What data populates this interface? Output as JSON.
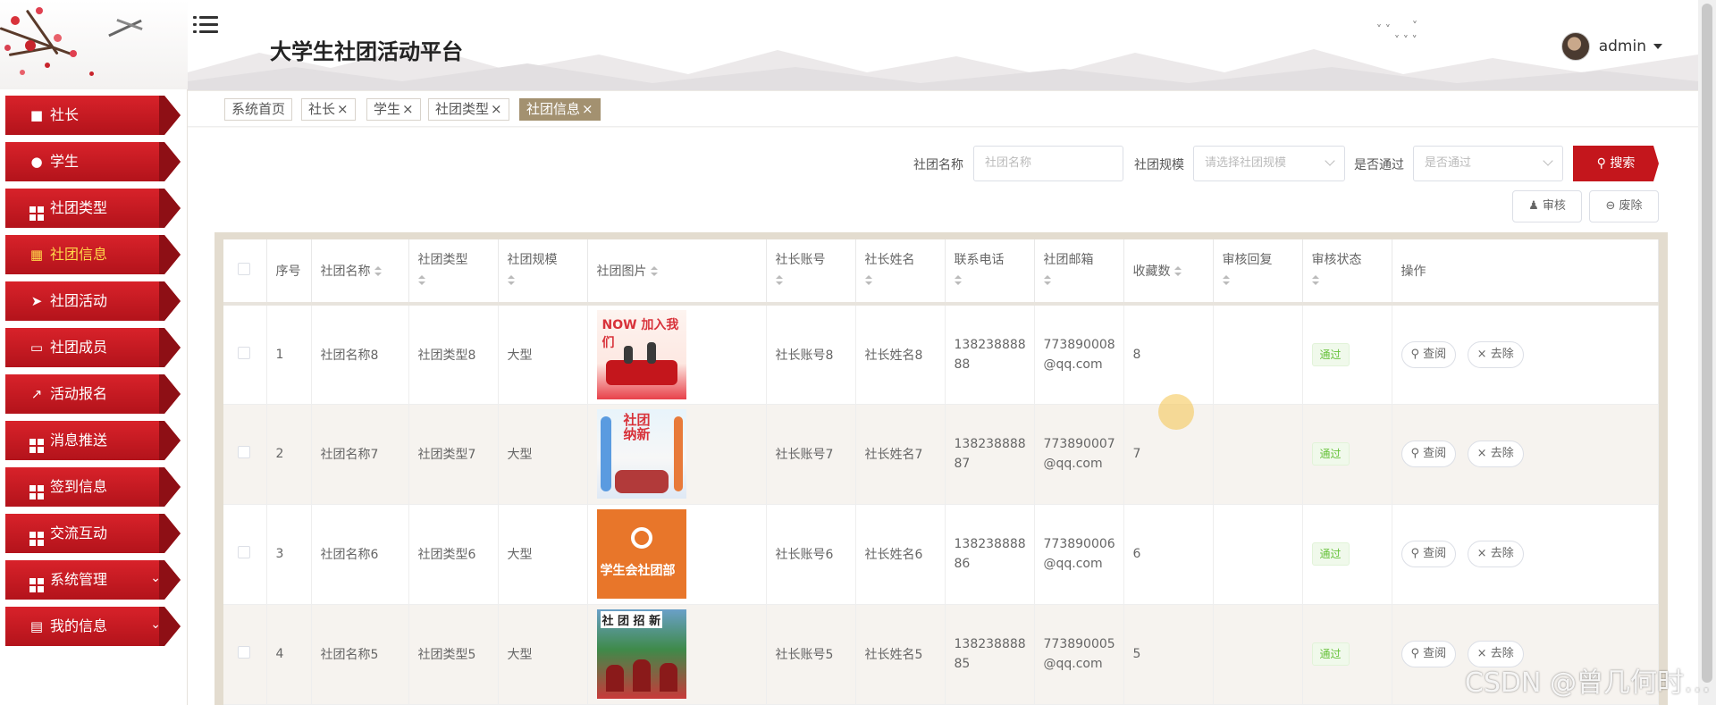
{
  "app": {
    "title": "大学生社团活动平台",
    "user": "admin"
  },
  "sidebar": {
    "items": [
      {
        "label": "社长",
        "icon": "chat-icon"
      },
      {
        "label": "学生",
        "icon": "user-icon"
      },
      {
        "label": "社团类型",
        "icon": "grid-icon"
      },
      {
        "label": "社团信息",
        "icon": "briefcase-icon",
        "active": true
      },
      {
        "label": "社团活动",
        "icon": "send-icon"
      },
      {
        "label": "社团成员",
        "icon": "monitor-icon"
      },
      {
        "label": "活动报名",
        "icon": "chart-icon"
      },
      {
        "label": "消息推送",
        "icon": "grid-icon"
      },
      {
        "label": "签到信息",
        "icon": "grid-icon"
      },
      {
        "label": "交流互动",
        "icon": "grid-icon"
      },
      {
        "label": "系统管理",
        "icon": "grid-icon",
        "expandable": true
      },
      {
        "label": "我的信息",
        "icon": "card-icon",
        "expandable": true
      }
    ]
  },
  "tabs": [
    {
      "label": "系统首页",
      "closable": false
    },
    {
      "label": "社长",
      "closable": true
    },
    {
      "label": "学生",
      "closable": true
    },
    {
      "label": "社团类型",
      "closable": true
    },
    {
      "label": "社团信息",
      "closable": true,
      "active": true
    }
  ],
  "search": {
    "name_label": "社团名称",
    "name_placeholder": "社团名称",
    "scale_label": "社团规模",
    "scale_placeholder": "请选择社团规模",
    "pass_label": "是否通过",
    "pass_placeholder": "是否通过",
    "search_button": "搜索",
    "audit_button": "审核",
    "delete_button": "废除"
  },
  "table": {
    "headers": [
      "序号",
      "社团名称",
      "社团类型",
      "社团规模",
      "社团图片",
      "社长账号",
      "社长姓名",
      "联系电话",
      "社团邮箱",
      "收藏数",
      "审核回复",
      "审核状态",
      "操作"
    ],
    "rows": [
      {
        "index": "1",
        "name": "社团名称8",
        "type": "社团类型8",
        "scale": "大型",
        "account": "社长账号8",
        "leader": "社长姓名8",
        "phone1": "138238888",
        "phone2": "88",
        "email1": "773890008",
        "email2": "@qq.com",
        "favorites": "8",
        "reply": "",
        "status": "通过"
      },
      {
        "index": "2",
        "name": "社团名称7",
        "type": "社团类型7",
        "scale": "大型",
        "account": "社长账号7",
        "leader": "社长姓名7",
        "phone1": "138238888",
        "phone2": "87",
        "email1": "773890007",
        "email2": "@qq.com",
        "favorites": "7",
        "reply": "",
        "status": "通过"
      },
      {
        "index": "3",
        "name": "社团名称6",
        "type": "社团类型6",
        "scale": "大型",
        "account": "社长账号6",
        "leader": "社长姓名6",
        "phone1": "138238888",
        "phone2": "86",
        "email1": "773890006",
        "email2": "@qq.com",
        "favorites": "6",
        "reply": "",
        "status": "通过"
      },
      {
        "index": "4",
        "name": "社团名称5",
        "type": "社团类型5",
        "scale": "大型",
        "account": "社长账号5",
        "leader": "社长姓名5",
        "phone1": "138238888",
        "phone2": "85",
        "email1": "773890005",
        "email2": "@qq.com",
        "favorites": "5",
        "reply": "",
        "status": "通过"
      }
    ],
    "view_label": "查阅",
    "remove_label": "去除",
    "image_texts": [
      "NOW 加入我们",
      "社团纳新",
      "学生会社团部",
      "社 团 招 新"
    ]
  },
  "watermark": "CSDN @曾几何时…",
  "colors": {
    "primary": "#c4161c",
    "active_text": "#ffd84a",
    "tab_active": "#a39170",
    "badge_text": "#67c23a"
  }
}
